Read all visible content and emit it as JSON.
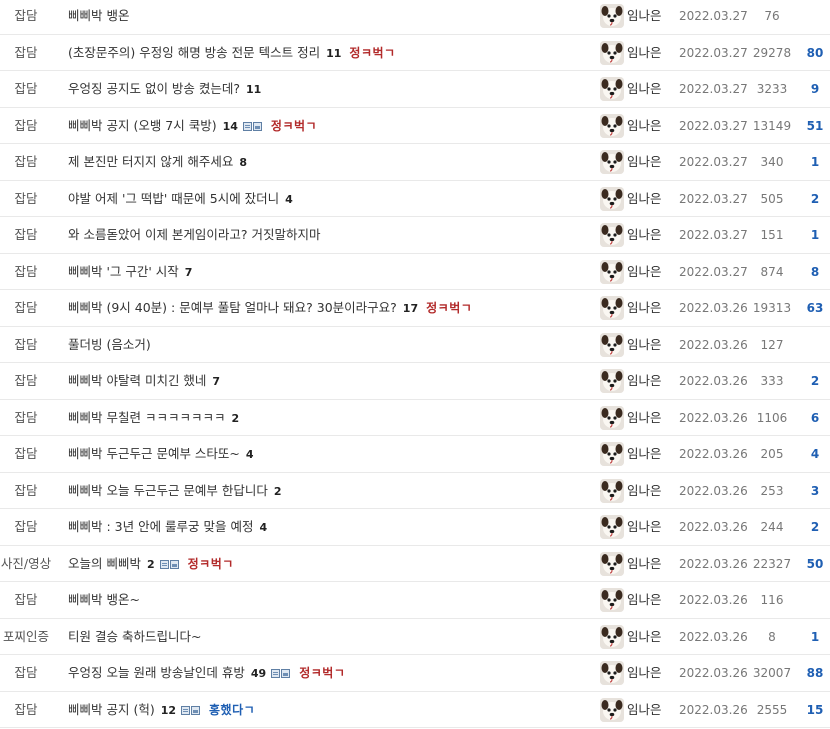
{
  "avatar_icon": "dog-face-icon",
  "colors": {
    "badge_red": "#b22a2a",
    "badge_blue": "#1f5fb3",
    "recommend": "#1f5fb3"
  },
  "posts": [
    {
      "category": "잡담",
      "title": "삐삐박 뱅온",
      "comments": "",
      "icons": [],
      "badge": "",
      "author": "임나은",
      "date": "2022.03.27",
      "views": "76",
      "recommends": ""
    },
    {
      "category": "잡담",
      "title": "(초장문주의) 우정잉 해명 방송 전문 텍스트 정리",
      "comments": "11",
      "icons": [],
      "badge": "정ㅋ벅ㄱ",
      "author": "임나은",
      "date": "2022.03.27",
      "views": "29278",
      "recommends": "80"
    },
    {
      "category": "잡담",
      "title": "우엉징 공지도 없이 방송 켰는데?",
      "comments": "11",
      "icons": [],
      "badge": "",
      "author": "임나은",
      "date": "2022.03.27",
      "views": "3233",
      "recommends": "9"
    },
    {
      "category": "잡담",
      "title": "삐삐박 공지 (오뱅 7시 쿡방)",
      "comments": "14",
      "icons": [
        "doc",
        "img"
      ],
      "badge": "정ㅋ벅ㄱ",
      "author": "임나은",
      "date": "2022.03.27",
      "views": "13149",
      "recommends": "51"
    },
    {
      "category": "잡담",
      "title": "제 본진만 터지지 않게 해주세요",
      "comments": "8",
      "icons": [],
      "badge": "",
      "author": "임나은",
      "date": "2022.03.27",
      "views": "340",
      "recommends": "1"
    },
    {
      "category": "잡담",
      "title": "야발 어제 '그 떡밥' 때문에 5시에 잤더니",
      "comments": "4",
      "icons": [],
      "badge": "",
      "author": "임나은",
      "date": "2022.03.27",
      "views": "505",
      "recommends": "2"
    },
    {
      "category": "잡담",
      "title": "와 소름돋았어 이제 본게임이라고? 거짓말하지마",
      "comments": "",
      "icons": [],
      "badge": "",
      "author": "임나은",
      "date": "2022.03.27",
      "views": "151",
      "recommends": "1"
    },
    {
      "category": "잡담",
      "title": "삐삐박 '그 구간' 시작",
      "comments": "7",
      "icons": [],
      "badge": "",
      "author": "임나은",
      "date": "2022.03.27",
      "views": "874",
      "recommends": "8"
    },
    {
      "category": "잡담",
      "title": "삐삐박 (9시 40분) : 문예부 풀탐 얼마나 돼요? 30분이라구요?",
      "comments": "17",
      "icons": [],
      "badge": "정ㅋ벅ㄱ",
      "author": "임나은",
      "date": "2022.03.26",
      "views": "19313",
      "recommends": "63"
    },
    {
      "category": "잡담",
      "title": "풀더빙 (음소거)",
      "comments": "",
      "icons": [],
      "badge": "",
      "author": "임나은",
      "date": "2022.03.26",
      "views": "127",
      "recommends": ""
    },
    {
      "category": "잡담",
      "title": "삐삐박 야탈력 미치긴 했네",
      "comments": "7",
      "icons": [],
      "badge": "",
      "author": "임나은",
      "date": "2022.03.26",
      "views": "333",
      "recommends": "2"
    },
    {
      "category": "잡담",
      "title": "삐삐박 무칠련 ㅋㅋㅋㅋㅋㅋㅋ",
      "comments": "2",
      "icons": [],
      "badge": "",
      "author": "임나은",
      "date": "2022.03.26",
      "views": "1106",
      "recommends": "6"
    },
    {
      "category": "잡담",
      "title": "삐삐박 두근두근 문예부 스타또~",
      "comments": "4",
      "icons": [],
      "badge": "",
      "author": "임나은",
      "date": "2022.03.26",
      "views": "205",
      "recommends": "4"
    },
    {
      "category": "잡담",
      "title": "삐삐박 오늘 두근두근 문예부 한답니다",
      "comments": "2",
      "icons": [],
      "badge": "",
      "author": "임나은",
      "date": "2022.03.26",
      "views": "253",
      "recommends": "3"
    },
    {
      "category": "잡담",
      "title": "삐삐박 : 3년 안에 룰루궁 맞을 예정",
      "comments": "4",
      "icons": [],
      "badge": "",
      "author": "임나은",
      "date": "2022.03.26",
      "views": "244",
      "recommends": "2"
    },
    {
      "category": "사진/영상",
      "title": "오늘의 삐삐박",
      "comments": "2",
      "icons": [
        "doc",
        "img"
      ],
      "badge": "정ㅋ벅ㄱ",
      "author": "임나은",
      "date": "2022.03.26",
      "views": "22327",
      "recommends": "50"
    },
    {
      "category": "잡담",
      "title": "삐삐박 뱅온~",
      "comments": "",
      "icons": [],
      "badge": "",
      "author": "임나은",
      "date": "2022.03.26",
      "views": "116",
      "recommends": ""
    },
    {
      "category": "포찌인증",
      "title": "티원 결승 축하드립니다~",
      "comments": "",
      "icons": [],
      "badge": "",
      "author": "임나은",
      "date": "2022.03.26",
      "views": "8",
      "recommends": "1"
    },
    {
      "category": "잡담",
      "title": "우엉징 오늘 원래 방송날인데 휴방",
      "comments": "49",
      "icons": [
        "doc",
        "img"
      ],
      "badge": "정ㅋ벅ㄱ",
      "author": "임나은",
      "date": "2022.03.26",
      "views": "32007",
      "recommends": "88"
    },
    {
      "category": "잡담",
      "title": "삐삐박 공지 (헉)",
      "comments": "12",
      "icons": [
        "doc",
        "img"
      ],
      "badge": "홍했다ㄱ",
      "badge_color": "blue",
      "author": "임나은",
      "date": "2022.03.26",
      "views": "2555",
      "recommends": "15"
    }
  ]
}
